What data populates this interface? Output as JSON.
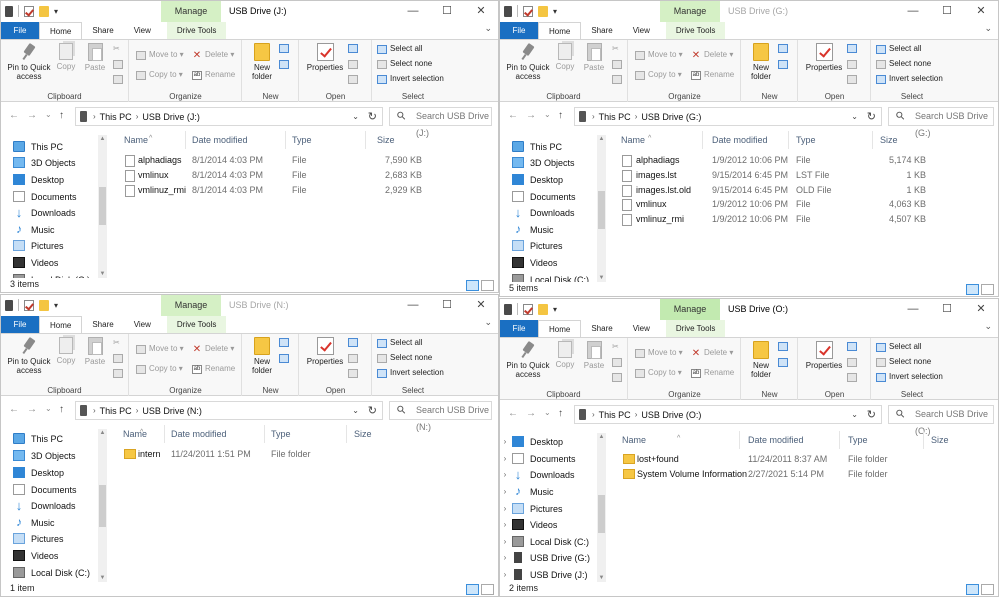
{
  "common": {
    "manage": "Manage",
    "tabs": {
      "file": "File",
      "home": "Home",
      "share": "Share",
      "view": "View",
      "drive_tools": "Drive Tools"
    },
    "ribbon": {
      "pin": "Pin to Quick access",
      "copy": "Copy",
      "paste": "Paste",
      "clipboard": "Clipboard",
      "move_to": "Move to ▾",
      "copy_to": "Copy to ▾",
      "delete": "Delete ▾",
      "rename": "Rename",
      "organize": "Organize",
      "new_folder": "New folder",
      "new": "New",
      "properties": "Properties",
      "open": "Open",
      "select_all": "Select all",
      "select_none": "Select none",
      "invert_selection": "Invert selection",
      "select": "Select"
    },
    "breadcrumb_root": "This PC",
    "columns": {
      "name": "Name",
      "date": "Date modified",
      "type": "Type",
      "size": "Size"
    },
    "nav": {
      "this_pc": "This PC",
      "objects": "3D Objects",
      "desktop": "Desktop",
      "documents": "Documents",
      "downloads": "Downloads",
      "music": "Music",
      "pictures": "Pictures",
      "videos": "Videos",
      "local_disk": "Local Disk (C:)",
      "usb_g": "USB Drive (G:)",
      "usb_j": "USB Drive (J:)",
      "local_disk_cut": "Local Disk (C:)"
    },
    "icons": [
      "pin-icon",
      "copy-icon",
      "paste-icon",
      "new-folder-icon",
      "properties-icon",
      "search-icon",
      "refresh-icon"
    ]
  },
  "windows": {
    "j": {
      "title": "USB Drive (J:)",
      "drive": "USB Drive (J:)",
      "search": "Search USB Drive (J:)",
      "status": "3 items",
      "files": [
        {
          "name": "alphadiags",
          "date": "8/1/2014 4:03 PM",
          "type": "File",
          "size": "7,590 KB"
        },
        {
          "name": "vmlinux",
          "date": "8/1/2014 4:03 PM",
          "type": "File",
          "size": "2,683 KB"
        },
        {
          "name": "vmlinuz_rmi",
          "date": "8/1/2014 4:03 PM",
          "type": "File",
          "size": "2,929 KB"
        }
      ]
    },
    "g": {
      "title": "USB Drive (G:)",
      "drive": "USB Drive (G:)",
      "search": "Search USB Drive (G:)",
      "status": "5 items",
      "files": [
        {
          "name": "alphadiags",
          "date": "1/9/2012 10:06 PM",
          "type": "File",
          "size": "5,174 KB"
        },
        {
          "name": "images.lst",
          "date": "9/15/2014 6:45 PM",
          "type": "LST File",
          "size": "1 KB"
        },
        {
          "name": "images.lst.old",
          "date": "9/15/2014 6:45 PM",
          "type": "OLD File",
          "size": "1 KB"
        },
        {
          "name": "vmlinux",
          "date": "1/9/2012 10:06 PM",
          "type": "File",
          "size": "4,063 KB"
        },
        {
          "name": "vmlinuz_rmi",
          "date": "1/9/2012 10:06 PM",
          "type": "File",
          "size": "4,507 KB"
        }
      ]
    },
    "n": {
      "title": "USB Drive (N:)",
      "drive": "USB Drive (N:)",
      "search": "Search USB Drive (N:)",
      "status": "1 item",
      "files": [
        {
          "name": "intern",
          "date": "11/24/2011 1:51 PM",
          "type": "File folder",
          "size": ""
        }
      ]
    },
    "o": {
      "title": "USB Drive (O:)",
      "drive": "USB Drive (O:)",
      "search": "Search USB Drive (O:)",
      "status": "2 items",
      "files": [
        {
          "name": "lost+found",
          "date": "11/24/2011 8:37 AM",
          "type": "File folder",
          "size": ""
        },
        {
          "name": "System Volume Information",
          "date": "2/27/2021 5:14 PM",
          "type": "File folder",
          "size": ""
        }
      ]
    }
  }
}
